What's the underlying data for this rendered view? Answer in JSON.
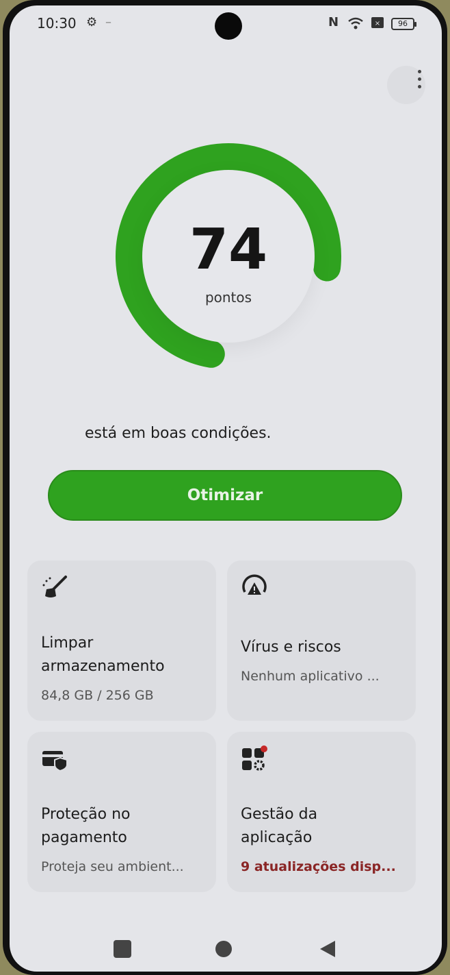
{
  "status_bar": {
    "time": "10:30",
    "battery": "96"
  },
  "score": {
    "value": "74",
    "unit": "pontos",
    "fraction": 0.74,
    "color": "#2fa21f"
  },
  "condition_text": "está em boas condições.",
  "optimize_label": "Otimizar",
  "cards": [
    {
      "title": "Limpar armazenamento",
      "title_line1": "Limpar",
      "title_line2": "armazenamento",
      "subtitle": "84,8 GB / 256 GB",
      "icon": "broom-icon"
    },
    {
      "title": "Vírus e riscos",
      "subtitle": "Nenhum aplicativo ...",
      "icon": "warning-shield-icon"
    },
    {
      "title_line1": "Proteção no",
      "title_line2": "pagamento",
      "subtitle": "Proteja seu ambient...",
      "icon": "card-shield-icon"
    },
    {
      "title_line1": "Gestão da",
      "title_line2": "aplicação",
      "subtitle": "9 atualizações disp...",
      "icon": "app-manage-icon",
      "subtitle_color": "#8a2525"
    }
  ],
  "nav": {
    "recents": "recents-icon",
    "home": "home-icon",
    "back": "back-icon"
  },
  "colors": {
    "accent": "#2fa21f",
    "background": "#e4e5e9",
    "card": "#dcdde1",
    "alert": "#8a2525"
  }
}
